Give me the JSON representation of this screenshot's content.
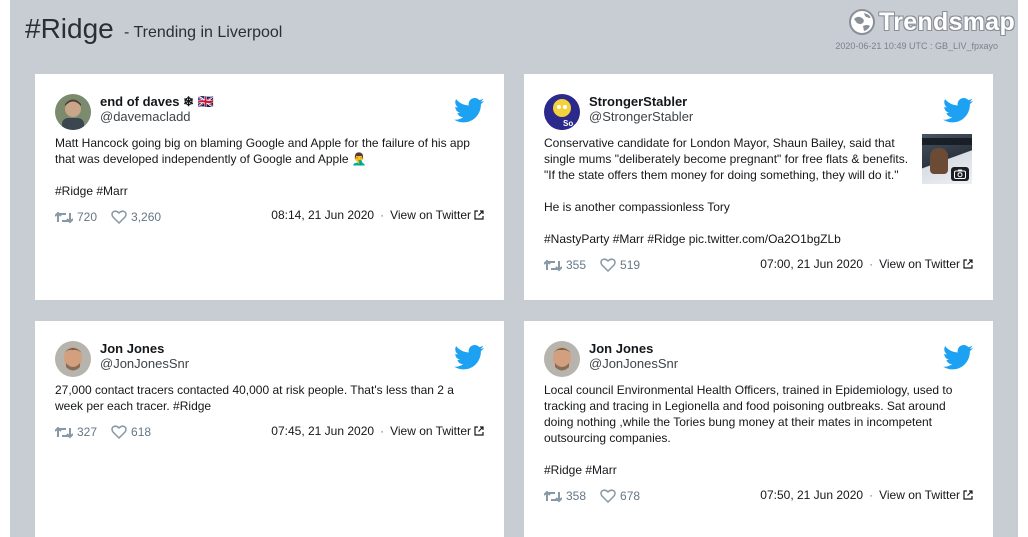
{
  "header": {
    "hashtag": "#Ridge",
    "subtitle": "- Trending in Liverpool",
    "brand": "Trendsmap",
    "stamp": "2020-06-21 10:49 UTC : GB_LIV_fpxayo"
  },
  "labels": {
    "view_on_twitter": "View on Twitter",
    "separator": "·"
  },
  "tweets": [
    {
      "name": "end of daves ❄ 🇬🇧",
      "handle": "@davemacladd",
      "paragraphs": [
        "Matt Hancock going big on blaming Google and Apple for the failure of his app that was developed independently of Google and Apple 🤦‍♂️",
        "#Ridge #Marr"
      ],
      "retweets": "720",
      "likes": "3,260",
      "date": "08:14, 21 Jun 2020"
    },
    {
      "name": "StrongerStabler",
      "handle": "@StrongerStabler",
      "avatar_badge": "So...",
      "paragraphs": [
        "Conservative candidate for London Mayor, Shaun Bailey, said that single mums \"deliberately become pregnant\" for free flats & benefits. \"If the state offers them money for doing something, they will do it.\"",
        "He is another compassionless Tory",
        "#NastyParty #Marr #Ridge pic.twitter.com/Oa2O1bgZLb"
      ],
      "retweets": "355",
      "likes": "519",
      "date": "07:00, 21 Jun 2020"
    },
    {
      "name": "Jon Jones",
      "handle": "@JonJonesSnr",
      "paragraphs": [
        "27,000 contact tracers contacted 40,000 at risk people. That's less than 2 a week per each tracer. #Ridge"
      ],
      "retweets": "327",
      "likes": "618",
      "date": "07:45, 21 Jun 2020"
    },
    {
      "name": "Jon Jones",
      "handle": "@JonJonesSnr",
      "paragraphs": [
        "Local council Environmental Health Officers, trained in Epidemiology, used to tracking and tracing in Legionella and food poisoning outbreaks. Sat around doing nothing ,while the Tories bung money at their mates in incompetent outsourcing companies.",
        "#Ridge #Marr"
      ],
      "retweets": "358",
      "likes": "678",
      "date": "07:50, 21 Jun 2020"
    }
  ],
  "colors": {
    "twitter_blue": "#1da1f2",
    "frame_gray": "#c8ccd3",
    "meta_gray": "#657786"
  },
  "icons": {
    "tweet_brand": "twitter-bird-icon",
    "retweet": "retweet-icon",
    "like": "heart-icon",
    "external": "external-link-icon",
    "photo": "camera-icon",
    "logo": "trendsmap-globe-icon"
  }
}
